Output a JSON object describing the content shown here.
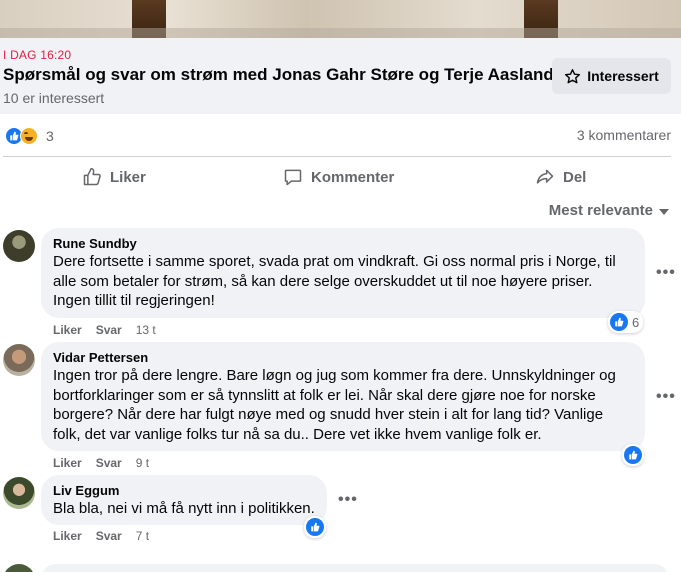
{
  "event": {
    "date": "I DAG 16:20",
    "title": "Spørsmål og svar om strøm med Jonas Gahr Støre og Terje Aasland",
    "interested_count": "10 er interessert",
    "interested_button": "Interessert"
  },
  "reactions": {
    "count": "3",
    "comments": "3 kommentarer",
    "icons": [
      "like-icon",
      "haha-icon"
    ]
  },
  "actions": {
    "like": "Liker",
    "comment": "Kommenter",
    "share": "Del"
  },
  "sort_label": "Mest relevante",
  "comments": [
    {
      "name": "Rune Sundby",
      "text": "Dere fortsette i samme sporet, svada prat om vindkraft. Gi oss normal pris i Norge, til alle som betaler for strøm, så kan dere selge overskuddet ut til noe høyere priser. Ingen tillit til regjeringen!",
      "like": "Liker",
      "reply": "Svar",
      "time": "13 t",
      "reaction_count": "6"
    },
    {
      "name": "Vidar Pettersen",
      "text": "Ingen tror på dere lengre. Bare løgn og jug som kommer fra dere. Unnskyldninger og bortforklaringer som er så tynnslitt at folk er lei. Når skal dere gjøre noe for norske borgere? Når dere har fulgt nøye med og snudd hver stein i alt for lang tid? Vanlige folk, det var vanlige folks tur nå sa du.. Dere vet ikke hvem vanlige folk er.",
      "like": "Liker",
      "reply": "Svar",
      "time": "9 t"
    },
    {
      "name": "Liv Eggum",
      "text": "Bla bla, nei vi må få nytt inn i politikken.",
      "like": "Liker",
      "reply": "Svar",
      "time": "7 t"
    }
  ],
  "more_label": "•••"
}
